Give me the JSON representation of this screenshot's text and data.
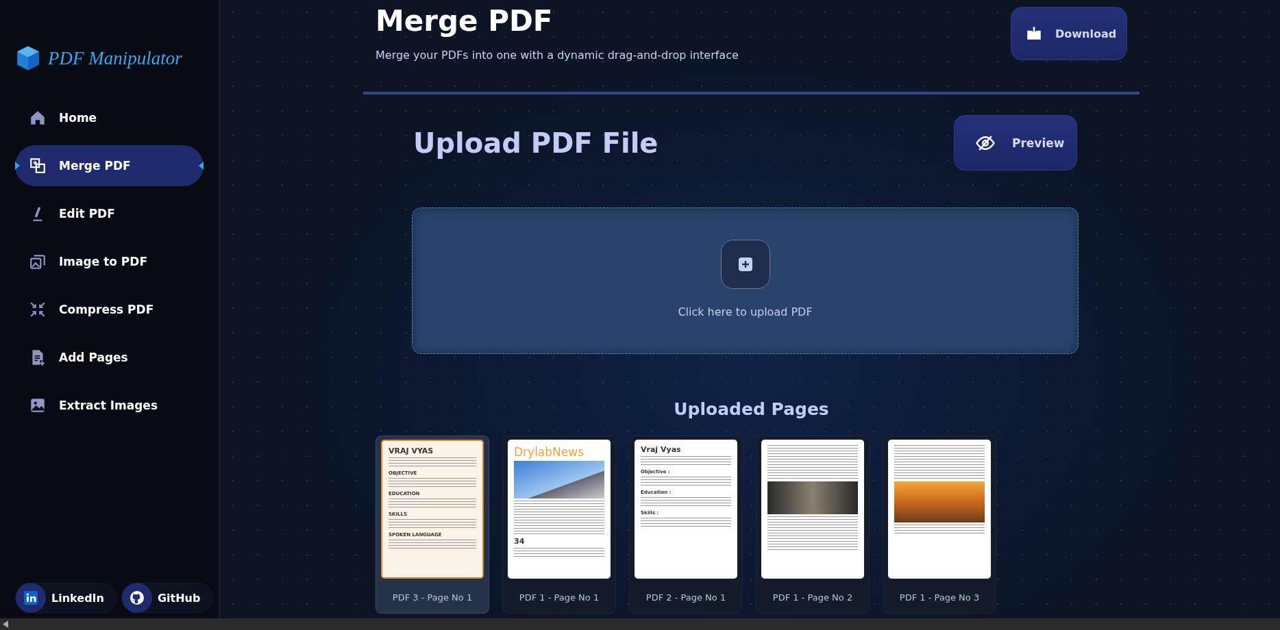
{
  "sidebar": {
    "logo": "PDF Manipulator",
    "items": [
      {
        "label": "Home",
        "selected": false
      },
      {
        "label": "Merge PDF",
        "selected": true
      },
      {
        "label": "Edit PDF",
        "selected": false
      },
      {
        "label": "Image to PDF",
        "selected": false
      },
      {
        "label": "Compress PDF",
        "selected": false
      },
      {
        "label": "Add Pages",
        "selected": false
      },
      {
        "label": "Extract Images",
        "selected": false
      }
    ],
    "social": [
      "LinkedIn",
      "GitHub"
    ]
  },
  "header": {
    "title": "Merge PDF",
    "subtitle": "Merge your PDFs into one with a dynamic drag-and-drop interface",
    "download_button": "Download"
  },
  "upload": {
    "title": "Upload PDF File",
    "preview_button": "Preview",
    "dropzone_text": "Click here to upload PDF"
  },
  "uploaded_pages": {
    "title": "Uploaded Pages",
    "pages": [
      {
        "caption": "PDF 3 - Page No 1",
        "selected": true,
        "kind": "resume",
        "headings": [
          "VRAJ VYAS",
          "OBJECTIVE",
          "EDUCATION",
          "SKILLS",
          "SPOKEN LANGUAGE"
        ]
      },
      {
        "caption": "PDF 1 - Page No 1",
        "selected": false,
        "kind": "newsletter",
        "headings": [
          "DrylabNews",
          "34"
        ]
      },
      {
        "caption": "PDF 2 - Page No 1",
        "selected": false,
        "kind": "letter",
        "headings": [
          "Vraj Vyas",
          "Objective :",
          "Education :",
          "Skills :"
        ]
      },
      {
        "caption": "PDF 1 - Page No 2",
        "selected": false,
        "kind": "article"
      },
      {
        "caption": "PDF 1 - Page No 3",
        "selected": false,
        "kind": "article-photo"
      }
    ]
  }
}
